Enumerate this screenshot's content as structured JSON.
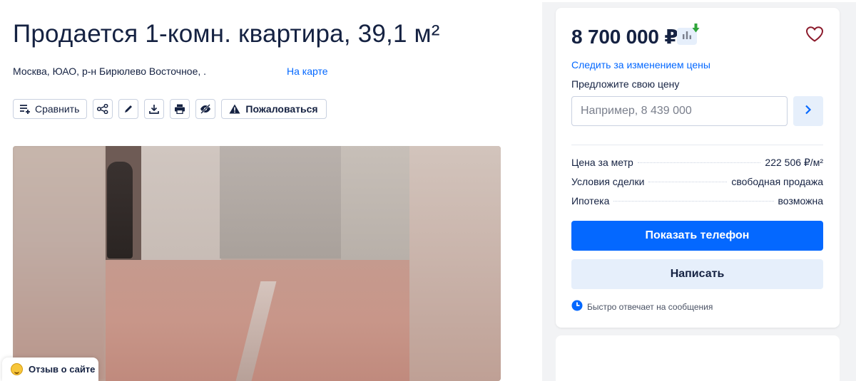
{
  "listing": {
    "title": "Продается 1-комн. квартира, 39,1 м²",
    "address": "Москва, ЮАО, р-н Бирюлево Восточное, .",
    "map_link": "На карте"
  },
  "toolbar": {
    "compare_label": "Сравнить",
    "report_label": "Пожаловаться"
  },
  "feedback": {
    "label": "Отзыв о сайте"
  },
  "sidebar": {
    "price": "8 700 000 ₽",
    "watch_price_link": "Следить за изменением цены",
    "offer_label": "Предложите свою цену",
    "offer_placeholder": "Например, 8 439 000",
    "details": [
      {
        "label": "Цена за метр",
        "value": "222 506 ₽/м²"
      },
      {
        "label": "Условия сделки",
        "value": "свободная продажа"
      },
      {
        "label": "Ипотека",
        "value": "возможна"
      }
    ],
    "show_phone_button": "Показать телефон",
    "write_button": "Написать",
    "fast_reply": "Быстро отвечает на сообщения"
  },
  "colors": {
    "accent": "#0468ff",
    "accent_light": "#e6effb",
    "text": "#152242",
    "heart": "#8b1a2b",
    "price_down_arrow": "#2fa53a"
  },
  "icons": [
    "compare-list-icon",
    "share-icon",
    "edit-icon",
    "download-icon",
    "print-icon",
    "hide-icon",
    "warning-icon",
    "price-chart-icon",
    "price-down-arrow-icon",
    "heart-icon",
    "chevron-right-icon",
    "clock-icon",
    "smile-emoji-icon"
  ]
}
